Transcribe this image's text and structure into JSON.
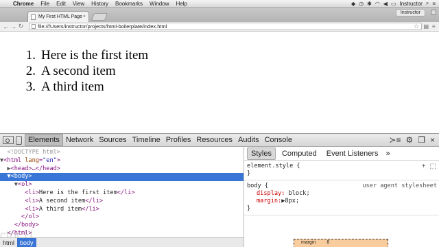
{
  "menubar": {
    "app": "Chrome",
    "items": [
      "File",
      "Edit",
      "View",
      "History",
      "Bookmarks",
      "Window",
      "Help"
    ],
    "user": "Instructor"
  },
  "tab": {
    "title": "My First HTML Page",
    "close": "×"
  },
  "user_chip": "Instructor",
  "toolbar": {
    "url": "file:///Users/instructor/projects/html-boilerplate/index.html"
  },
  "page": {
    "items": [
      {
        "num": "1.",
        "text": "Here is the first item"
      },
      {
        "num": "2.",
        "text": "A second item"
      },
      {
        "num": "3.",
        "text": "A third item"
      }
    ]
  },
  "devtools": {
    "tabs": [
      "Elements",
      "Network",
      "Sources",
      "Timeline",
      "Profiles",
      "Resources",
      "Audits",
      "Console"
    ],
    "active_tab": "Elements",
    "dom": {
      "doctype": "<!DOCTYPE html>",
      "html_open": "<html ",
      "lang_attr": "lang",
      "lang_val": "\"en\"",
      "head": "<head>…</head>",
      "body": "<body>",
      "ol_open": "<ol>",
      "li1": "Here is the first item",
      "li2": "A second item",
      "li3": "A third item",
      "ol_close": "</ol>",
      "body_close": "</body>",
      "html_close": "</html>"
    },
    "breadcrumbs": [
      "html",
      "body"
    ],
    "styles_tabs": [
      "Styles",
      "Computed",
      "Event Listeners"
    ],
    "styles_more": "»",
    "element_style": {
      "selector": "element.style {",
      "close": "}"
    },
    "body_rule": {
      "selector": "body {",
      "source": "user agent stylesheet",
      "props": [
        {
          "name": "display",
          "value": "block;"
        },
        {
          "name": "margin",
          "value": "8px;"
        }
      ],
      "close": "}"
    },
    "box_model": {
      "label": "margin",
      "value": "8"
    }
  },
  "watermark": "ctor U"
}
